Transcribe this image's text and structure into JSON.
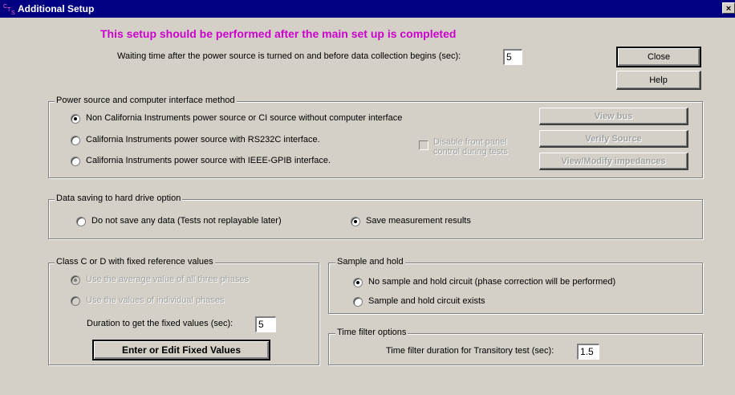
{
  "window": {
    "title": "Additional Setup",
    "icon": "cts-app-icon",
    "close_glyph": "×"
  },
  "header": {
    "headline": "This setup should be performed after the main set up is completed",
    "waiting_label": "Waiting time after the power source is turned on and before data collection begins (sec):",
    "waiting_value": "5"
  },
  "buttons": {
    "close": "Close",
    "help": "Help",
    "view_bus": "View bus",
    "verify_source": "Verify Source",
    "view_modify_impedances": "View/Modify impedances",
    "enter_edit_fixed": "Enter or Edit Fixed Values"
  },
  "power_source": {
    "legend": "Power source and computer interface method",
    "options": [
      {
        "label": "Non California Instruments power source or  CI source without computer interface",
        "checked": true
      },
      {
        "label": "California Instruments power source with RS232C interface.",
        "checked": false
      },
      {
        "label": "California Instruments power source with IEEE-GPIB interface.",
        "checked": false
      }
    ],
    "disable_front_panel_line1": "Disable front panel",
    "disable_front_panel_line2": "control during tests"
  },
  "data_saving": {
    "legend": "Data saving to hard drive option",
    "options": [
      {
        "label": "Do not save any data (Tests not replayable later)",
        "checked": false
      },
      {
        "label": "Save measurement results",
        "checked": true
      }
    ]
  },
  "class_cd": {
    "legend": "Class C or D with fixed reference values",
    "options": [
      {
        "label": "Use the average value of all three phases",
        "checked": true
      },
      {
        "label": "Use the values of individual phases",
        "checked": false
      }
    ],
    "duration_label": "Duration to get the fixed values (sec):",
    "duration_value": "5"
  },
  "sample_hold": {
    "legend": "Sample and hold",
    "options": [
      {
        "label": "No sample and hold circuit (phase correction will be performed)",
        "checked": true
      },
      {
        "label": "Sample and hold circuit exists",
        "checked": false
      }
    ]
  },
  "time_filter": {
    "legend": "Time filter options",
    "label": "Time filter duration for Transitory test (sec):",
    "value": "1.5"
  }
}
